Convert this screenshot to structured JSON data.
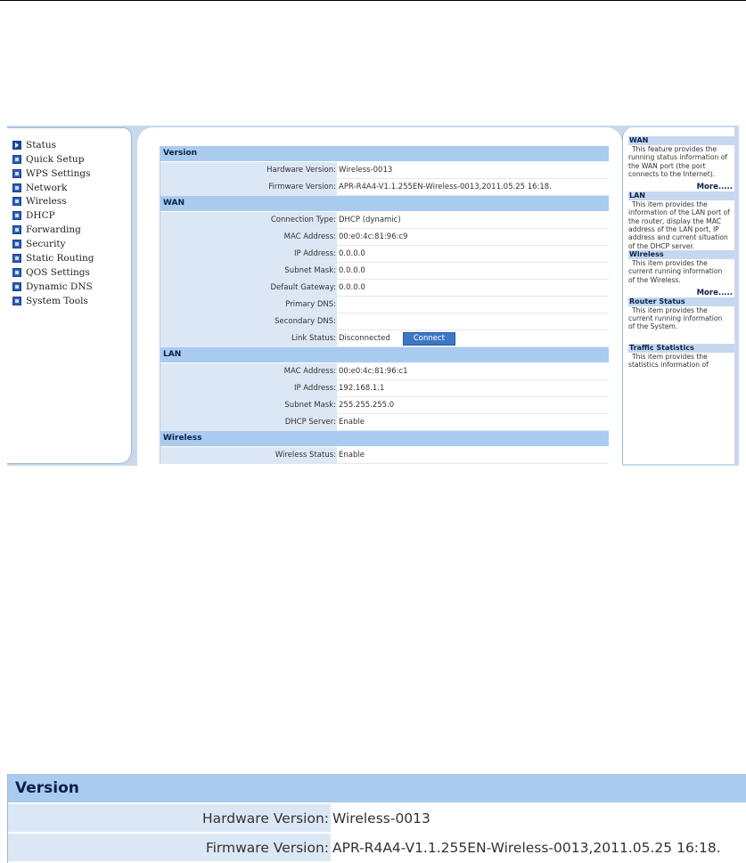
{
  "menu": {
    "items": [
      {
        "label": "Status",
        "active": true
      },
      {
        "label": "Quick Setup",
        "active": false
      },
      {
        "label": "WPS Settings",
        "active": false
      },
      {
        "label": "Network",
        "active": false
      },
      {
        "label": "Wireless",
        "active": false
      },
      {
        "label": "DHCP",
        "active": false
      },
      {
        "label": "Forwarding",
        "active": false
      },
      {
        "label": "Security",
        "active": false
      },
      {
        "label": "Static Routing",
        "active": false
      },
      {
        "label": "QOS Settings",
        "active": false
      },
      {
        "label": "Dynamic DNS",
        "active": false
      },
      {
        "label": "System Tools",
        "active": false
      }
    ]
  },
  "status": {
    "version": {
      "title": "Version",
      "hardware_label": "Hardware Version:",
      "hardware_value": "Wireless-0013",
      "firmware_label": "Firmware Version:",
      "firmware_value": "APR-R4A4-V1.1.255EN-Wireless-0013,2011.05.25 16:18."
    },
    "wan": {
      "title": "WAN",
      "connection_type_label": "Connection Type:",
      "connection_type_value": "DHCP (dynamic)",
      "mac_label": "MAC Address:",
      "mac_value": "00:e0:4c:81:96:c9",
      "ip_label": "IP Address:",
      "ip_value": "0.0.0.0",
      "subnet_label": "Subnet Mask:",
      "subnet_value": "0.0.0.0",
      "gateway_label": "Default Gateway:",
      "gateway_value": "0.0.0.0",
      "primary_dns_label": "Primary DNS:",
      "primary_dns_value": "",
      "secondary_dns_label": "Secondary DNS:",
      "secondary_dns_value": "",
      "link_status_label": "Link Status:",
      "link_status_value": "Disconnected",
      "connect_button": "Connect"
    },
    "lan": {
      "title": "LAN",
      "mac_label": "MAC Address:",
      "mac_value": "00:e0:4c:81:96:c1",
      "ip_label": "IP Address:",
      "ip_value": "192.168.1.1",
      "subnet_label": "Subnet Mask:",
      "subnet_value": "255.255.255.0",
      "dhcp_label": "DHCP Server:",
      "dhcp_value": "Enable"
    },
    "wireless": {
      "title": "Wireless",
      "status_label": "Wireless Status:",
      "status_value": "Enable"
    }
  },
  "help": {
    "wan": {
      "title": "WAN",
      "text": "This feature provides the running status information of the WAN port (the port connects to the Internet).",
      "more": "More....."
    },
    "lan": {
      "title": "LAN",
      "text": "This item provides the information of the LAN port of the router, display the MAC address of the LAN port, IP address and current situation of the DHCP server."
    },
    "wireless": {
      "title": "Wireless",
      "text": "This item provides the current running information of the Wireless.",
      "more": "More....."
    },
    "router": {
      "title": "Router Status",
      "text": "This item provides the current running information of the System."
    },
    "traffic": {
      "title": "Traffic Statistics",
      "text": "This item provides the statistics information of"
    }
  },
  "zoom": {
    "title": "Version",
    "hardware_label": "Hardware Version:",
    "hardware_value": "Wireless-0013",
    "firmware_label": "Firmware Version:",
    "firmware_value": "APR-R4A4-V1.1.255EN-Wireless-0013,2011.05.25 16:18."
  }
}
